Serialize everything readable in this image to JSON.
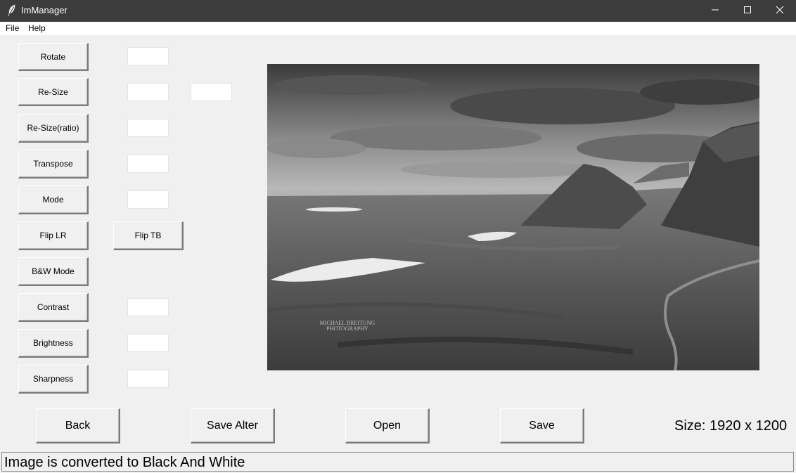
{
  "window": {
    "title": "ImManager",
    "controls": [
      "minimize",
      "maximize",
      "close"
    ]
  },
  "menu": {
    "items": [
      "File",
      "Help"
    ]
  },
  "tools": {
    "rotate": "Rotate",
    "resize": "Re-Size",
    "resize_ratio": "Re-Size(ratio)",
    "transpose": "Transpose",
    "mode": "Mode",
    "flip_lr": "Flip LR",
    "flip_tb": "Flip TB",
    "bw_mode": "B&W Mode",
    "contrast": "Contrast",
    "brightness": "Brightness",
    "sharpness": "Sharpness"
  },
  "inputs": {
    "rotate": "",
    "resize_width": "",
    "resize_height": "",
    "resize_ratio": "",
    "transpose": "",
    "mode": "",
    "contrast": "",
    "brightness": "",
    "sharpness": ""
  },
  "preview": {
    "watermark_line1": "MICHAEL BREITUNG",
    "watermark_line2": "PHOTOGRAPHY"
  },
  "actions": {
    "back": "Back",
    "save_alter": "Save Alter",
    "open": "Open",
    "save": "Save"
  },
  "image_size": "Size: 1920 x 1200",
  "status": "Image is converted to Black And White",
  "icons": [
    "feather-icon",
    "minimize-icon",
    "maximize-icon",
    "close-icon"
  ]
}
